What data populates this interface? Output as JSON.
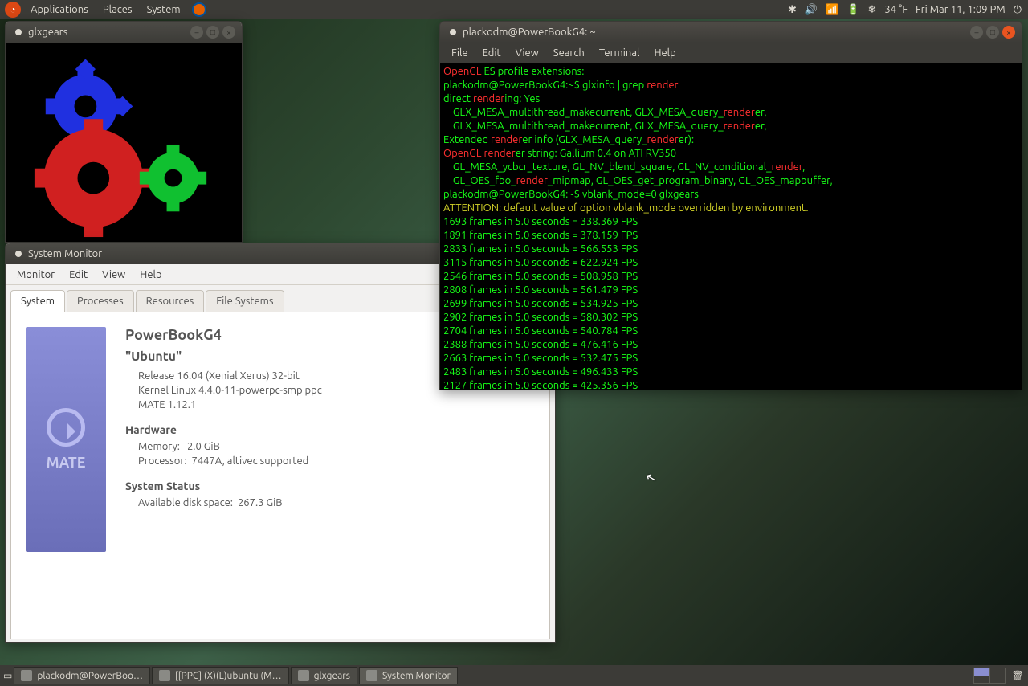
{
  "top_panel": {
    "menus": [
      "Applications",
      "Places",
      "System"
    ],
    "tray": {
      "temp": "34 °F",
      "datetime": "Fri Mar 11, 1:09 PM"
    }
  },
  "glxgears": {
    "title": "glxgears"
  },
  "system_monitor": {
    "title": "System Monitor",
    "menus": [
      "Monitor",
      "Edit",
      "View",
      "Help"
    ],
    "tabs": [
      "System",
      "Processes",
      "Resources",
      "File Systems"
    ],
    "active_tab": 0,
    "hostname": "PowerBookG4",
    "distro": "\"Ubuntu\"",
    "release": "Release 16.04 (Xenial Xerus) 32-bit",
    "kernel": "Kernel Linux 4.4.0-11-powerpc-smp ppc",
    "de": "MATE 1.12.1",
    "hardware_h": "Hardware",
    "memory_l": "Memory:",
    "memory_v": "2.0 GiB",
    "processor_l": "Processor:",
    "processor_v": "7447A, altivec supported",
    "status_h": "System Status",
    "disk_l": "Available disk space:",
    "disk_v": "267.3 GiB",
    "badge": "MATE"
  },
  "terminal": {
    "title": "plackodm@PowerBookG4: ~",
    "menus": [
      "File",
      "Edit",
      "View",
      "Search",
      "Terminal",
      "Help"
    ],
    "lines": [
      {
        "seg": [
          [
            "red",
            "OpenGL"
          ],
          [
            "green",
            " ES profile extensions:"
          ]
        ]
      },
      {
        "seg": [
          [
            "green",
            "plackodm@PowerBookG4:~$ glxinfo | grep "
          ],
          [
            "red",
            "render"
          ]
        ]
      },
      {
        "seg": [
          [
            "green",
            "direct "
          ],
          [
            "red",
            "render"
          ],
          [
            "green",
            "ing: Yes"
          ]
        ]
      },
      {
        "seg": [
          [
            "green",
            "    GLX_MESA_multithread_makecurrent, GLX_MESA_query_"
          ],
          [
            "red",
            "render"
          ],
          [
            "green",
            "er,"
          ]
        ]
      },
      {
        "seg": [
          [
            "green",
            "    GLX_MESA_multithread_makecurrent, GLX_MESA_query_"
          ],
          [
            "red",
            "render"
          ],
          [
            "green",
            "er,"
          ]
        ]
      },
      {
        "seg": [
          [
            "green",
            "Extended "
          ],
          [
            "red",
            "render"
          ],
          [
            "green",
            "er info (GLX_MESA_query_"
          ],
          [
            "red",
            "render"
          ],
          [
            "green",
            "er):"
          ]
        ]
      },
      {
        "seg": [
          [
            "red",
            "OpenGL"
          ],
          [
            "green",
            " "
          ],
          [
            "red",
            "render"
          ],
          [
            "green",
            "er string: Gallium 0.4 on ATI RV350"
          ]
        ]
      },
      {
        "seg": [
          [
            "green",
            "    GL_MESA_ycbcr_texture, GL_NV_blend_square, GL_NV_conditional_"
          ],
          [
            "red",
            "render"
          ],
          [
            "green",
            ","
          ]
        ]
      },
      {
        "seg": [
          [
            "green",
            "    GL_OES_fbo_"
          ],
          [
            "red",
            "render"
          ],
          [
            "green",
            "_mipmap, GL_OES_get_program_binary, GL_OES_mapbuffer,"
          ]
        ]
      },
      {
        "seg": [
          [
            "green",
            "plackodm@PowerBookG4:~$ vblank_mode=0 glxgears"
          ]
        ]
      },
      {
        "seg": [
          [
            "yellow",
            "ATTENTION: default value of option vblank_mode overridden by environment."
          ]
        ]
      },
      {
        "seg": [
          [
            "green",
            "1693 frames in 5.0 seconds = 338.369 FPS"
          ]
        ]
      },
      {
        "seg": [
          [
            "green",
            "1891 frames in 5.0 seconds = 378.159 FPS"
          ]
        ]
      },
      {
        "seg": [
          [
            "green",
            "2833 frames in 5.0 seconds = 566.553 FPS"
          ]
        ]
      },
      {
        "seg": [
          [
            "green",
            "3115 frames in 5.0 seconds = 622.924 FPS"
          ]
        ]
      },
      {
        "seg": [
          [
            "green",
            "2546 frames in 5.0 seconds = 508.958 FPS"
          ]
        ]
      },
      {
        "seg": [
          [
            "green",
            "2808 frames in 5.0 seconds = 561.479 FPS"
          ]
        ]
      },
      {
        "seg": [
          [
            "green",
            "2699 frames in 5.0 seconds = 534.925 FPS"
          ]
        ]
      },
      {
        "seg": [
          [
            "green",
            "2902 frames in 5.0 seconds = 580.302 FPS"
          ]
        ]
      },
      {
        "seg": [
          [
            "green",
            "2704 frames in 5.0 seconds = 540.784 FPS"
          ]
        ]
      },
      {
        "seg": [
          [
            "green",
            "2388 frames in 5.0 seconds = 476.416 FPS"
          ]
        ]
      },
      {
        "seg": [
          [
            "green",
            "2663 frames in 5.0 seconds = 532.475 FPS"
          ]
        ]
      },
      {
        "seg": [
          [
            "green",
            "2483 frames in 5.0 seconds = 496.433 FPS"
          ]
        ]
      },
      {
        "seg": [
          [
            "green",
            "2127 frames in 5.0 seconds = 425.356 FPS"
          ]
        ]
      }
    ]
  },
  "taskbar": {
    "items": [
      "plackodm@PowerBoo…",
      "[[PPC] (X)(L)ubuntu (M…",
      "glxgears",
      "System Monitor"
    ]
  }
}
